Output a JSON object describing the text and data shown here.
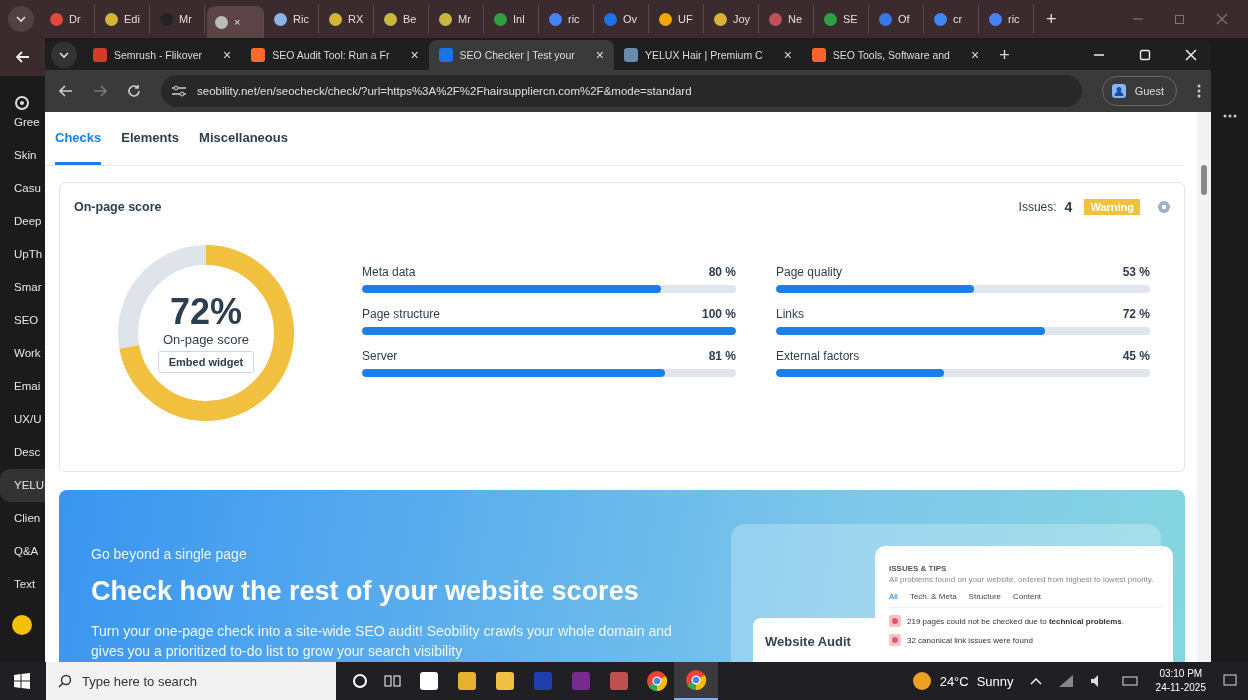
{
  "os_tabs": [
    {
      "label": "Dr",
      "selected": false,
      "color": "#e04a3a"
    },
    {
      "label": "Edi",
      "selected": false,
      "color": "#d9b23a"
    },
    {
      "label": "Mr",
      "selected": false,
      "color": "#222222"
    },
    {
      "selected": true,
      "close": "×",
      "color": "#bbbbbb"
    },
    {
      "label": "Ric",
      "selected": false,
      "color": "#8ab4e8"
    },
    {
      "label": "RX",
      "selected": false,
      "color": "#d9b23a"
    },
    {
      "label": "Be",
      "selected": false,
      "color": "#c8b840"
    },
    {
      "label": "Mr",
      "selected": false,
      "color": "#c8b840"
    },
    {
      "label": "Inl",
      "selected": false,
      "color": "#2ea043"
    },
    {
      "label": "ric",
      "selected": false,
      "color": "#4285f4"
    },
    {
      "label": "Ov",
      "selected": false,
      "color": "#1a73e8"
    },
    {
      "label": "UF",
      "selected": false,
      "color": "#f2a600"
    },
    {
      "label": "Joy",
      "selected": false,
      "color": "#d9b23a"
    },
    {
      "label": "Ne",
      "selected": false,
      "color": "#c0505a"
    },
    {
      "label": "SE",
      "selected": false,
      "color": "#2ea043"
    },
    {
      "label": "Of",
      "selected": false,
      "color": "#3b78e7"
    },
    {
      "label": "cr",
      "selected": false,
      "color": "#4285f4"
    },
    {
      "label": "ric",
      "selected": false,
      "color": "#4285f4"
    }
  ],
  "os_new_tab": "+",
  "side_items": [
    {
      "label": "Gree",
      "selected": false
    },
    {
      "label": "Skin",
      "selected": false
    },
    {
      "label": "Casu",
      "selected": false
    },
    {
      "label": "Deep",
      "selected": false
    },
    {
      "label": "UpTh",
      "selected": false
    },
    {
      "label": "Smar",
      "selected": false
    },
    {
      "label": "SEO",
      "selected": false
    },
    {
      "label": "Work",
      "selected": false
    },
    {
      "label": "Emai",
      "selected": false
    },
    {
      "label": "UX/U",
      "selected": false
    },
    {
      "label": "Desc",
      "selected": false
    },
    {
      "label": "YELU",
      "selected": true
    },
    {
      "label": "Clien",
      "selected": false
    },
    {
      "label": "Q&A",
      "selected": false
    },
    {
      "label": "Text",
      "selected": false
    }
  ],
  "browser": {
    "tabs": [
      {
        "title": "Semrush - Flikover",
        "selected": false,
        "close": "×",
        "color": "#d23a2a"
      },
      {
        "title": "SEO Audit Tool: Run a Fr",
        "selected": false,
        "close": "×",
        "color": "#ff6a2a"
      },
      {
        "title": "SEO Checker | Test your",
        "selected": true,
        "close": "×",
        "color": "#1a73e8"
      },
      {
        "title": "YELUX Hair | Premium C",
        "selected": false,
        "close": "×",
        "color": "#6a8ab0"
      },
      {
        "title": "SEO Tools, Software and",
        "selected": false,
        "close": "×",
        "color": "#ff642d"
      }
    ],
    "new_tab": "+",
    "url": "seobility.net/en/seocheck/check/?url=https%3A%2F%2Fhairsuppliercn.com%2F&mode=standard",
    "profile": "Guest"
  },
  "page": {
    "tabs": [
      {
        "label": "Checks",
        "selected": true
      },
      {
        "label": "Elements",
        "selected": false
      },
      {
        "label": "Miscellaneous",
        "selected": false
      }
    ],
    "score_card": {
      "title": "On-page score",
      "issues_label": "Issues:",
      "issues_count": "4",
      "badge": "Warning",
      "score": {
        "value": "72%",
        "label": "On-page score",
        "level": 0.72,
        "button": "Embed widget"
      },
      "metrics": [
        {
          "name": "Meta data",
          "reading": "80 %",
          "level": 0.8
        },
        {
          "name": "Page quality",
          "reading": "53 %",
          "level": 0.53
        },
        {
          "name": "Page structure",
          "reading": "100 %",
          "level": 1.0
        },
        {
          "name": "Links",
          "reading": "72 %",
          "level": 0.72
        },
        {
          "name": "Server",
          "reading": "81 %",
          "level": 0.81
        },
        {
          "name": "External factors",
          "reading": "45 %",
          "level": 0.45
        }
      ]
    },
    "promo": {
      "eyebrow": "Go beyond a single page",
      "heading": "Check how the rest of your website scores",
      "text": "Turn your one-page check into a site-wide SEO audit! Seobility crawls your whole domain and gives you a prioritized to-do list to grow your search visibility",
      "audit_title": "Website Audit",
      "issues": {
        "title": "ISSUES & TIPS",
        "subtitle": "All problems found on your website, ordered from highest to lowest priority.",
        "tabs": [
          {
            "label": "All",
            "selected": true
          },
          {
            "label": "Tech. & Meta",
            "selected": false
          },
          {
            "label": "Structure",
            "selected": false
          },
          {
            "label": "Content",
            "selected": false
          }
        ],
        "items": [
          "219 pages could not be checked due to **technical problems**.",
          "32 canonical link issues were found"
        ]
      }
    }
  },
  "taskbar": {
    "search_placeholder": "Type here to search",
    "temperature": "24°C",
    "weather": "Sunny",
    "time": "03:10 PM",
    "date": "24-11-2025"
  }
}
